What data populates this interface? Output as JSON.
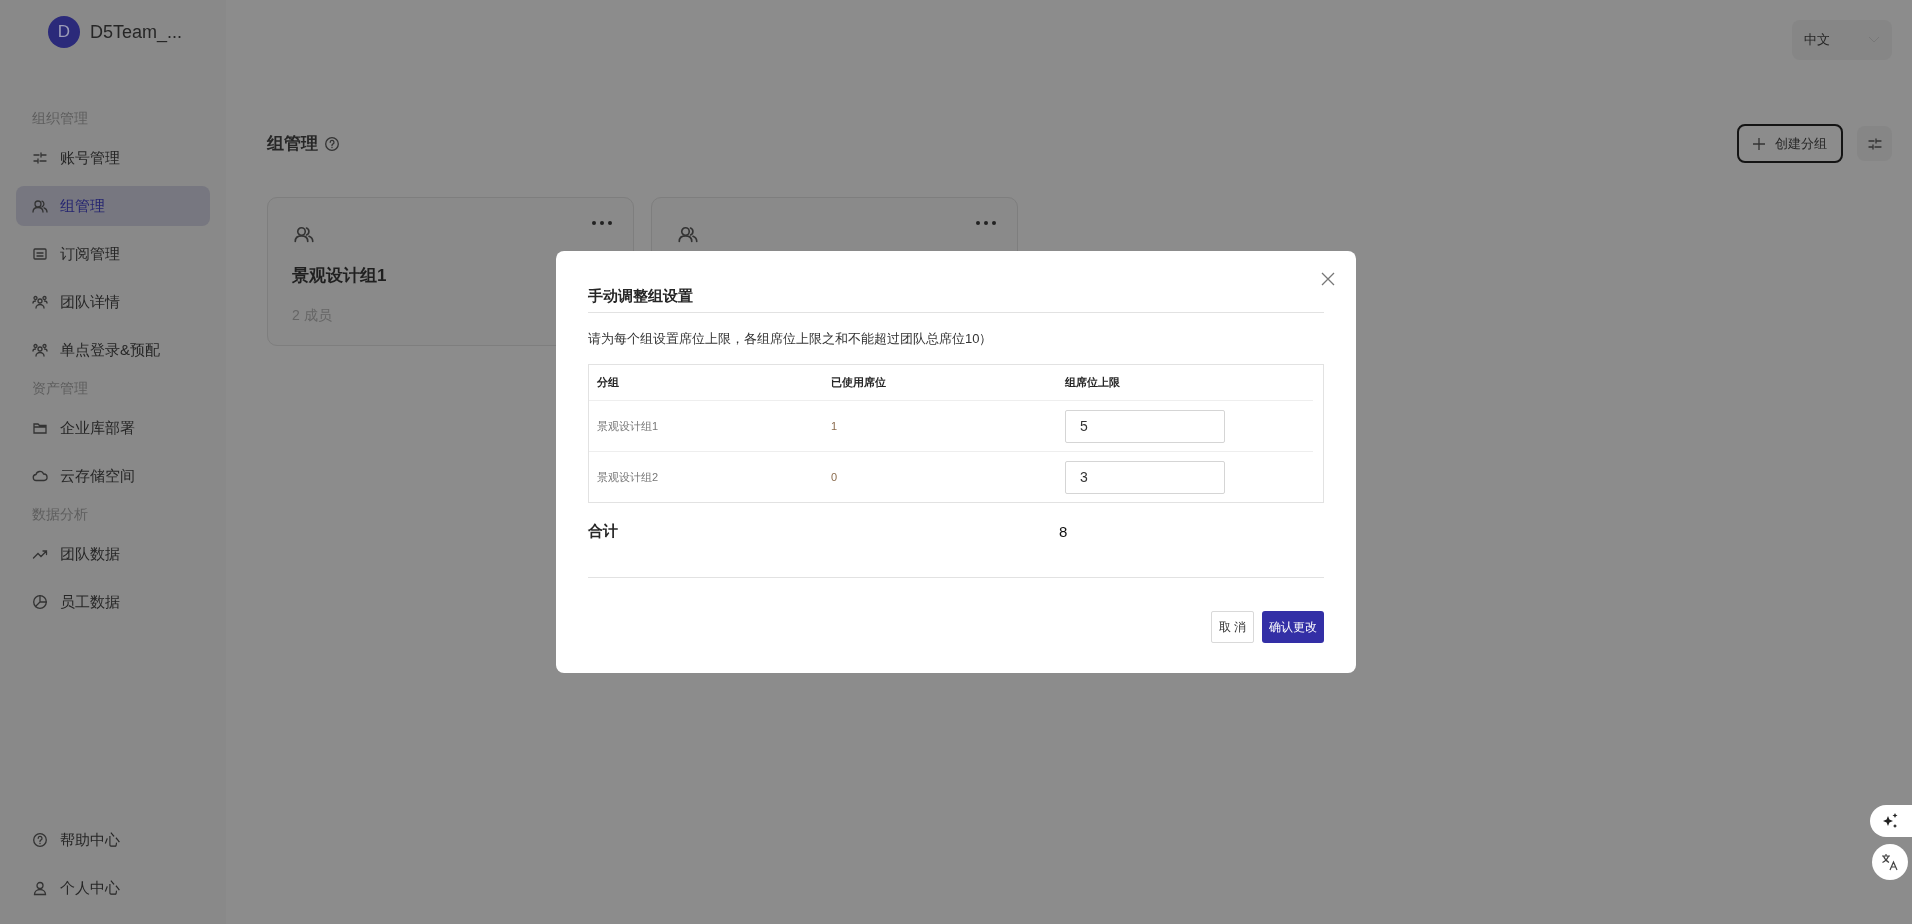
{
  "sidebar": {
    "team": {
      "avatar": "D",
      "name": "D5Team_..."
    },
    "sections": [
      {
        "title": "组织管理",
        "items": [
          {
            "label": "账号管理",
            "kind": "sliders",
            "selected": false
          },
          {
            "label": "组管理",
            "kind": "users",
            "selected": true
          },
          {
            "label": "订阅管理",
            "kind": "list",
            "selected": false
          },
          {
            "label": "团队详情",
            "kind": "team",
            "selected": false
          },
          {
            "label": "单点登录&预配",
            "kind": "team",
            "selected": false
          }
        ]
      },
      {
        "title": "资产管理",
        "items": [
          {
            "label": "企业库部署",
            "kind": "folder",
            "selected": false
          },
          {
            "label": "云存储空间",
            "kind": "cloud",
            "selected": false
          }
        ]
      },
      {
        "title": "数据分析",
        "items": [
          {
            "label": "团队数据",
            "kind": "trend",
            "selected": false
          },
          {
            "label": "员工数据",
            "kind": "pie",
            "selected": false
          }
        ]
      }
    ],
    "footer": [
      {
        "label": "帮助中心",
        "kind": "help"
      },
      {
        "label": "个人中心",
        "kind": "user"
      }
    ]
  },
  "language": {
    "value": "中文"
  },
  "page": {
    "title": "组管理",
    "create_button": "创建分组",
    "cards": [
      {
        "kind": "group",
        "name": "景观设计组1",
        "members": "2 成员"
      },
      {
        "kind": "covered"
      }
    ]
  },
  "dialog": {
    "title": "手动调整组设置",
    "description": "请为每个组设置席位上限，各组席位上限之和不能超过团队总席位10）",
    "columns": [
      "分组",
      "已使用席位",
      "组席位上限"
    ],
    "rows": [
      {
        "group": "景观设计组1",
        "used": "1",
        "limit": "5"
      },
      {
        "group": "景观设计组2",
        "used": "0",
        "limit": "3"
      }
    ],
    "total": {
      "label": "合计",
      "value": "8"
    },
    "cancel": "取 消",
    "confirm": "确认更改"
  }
}
